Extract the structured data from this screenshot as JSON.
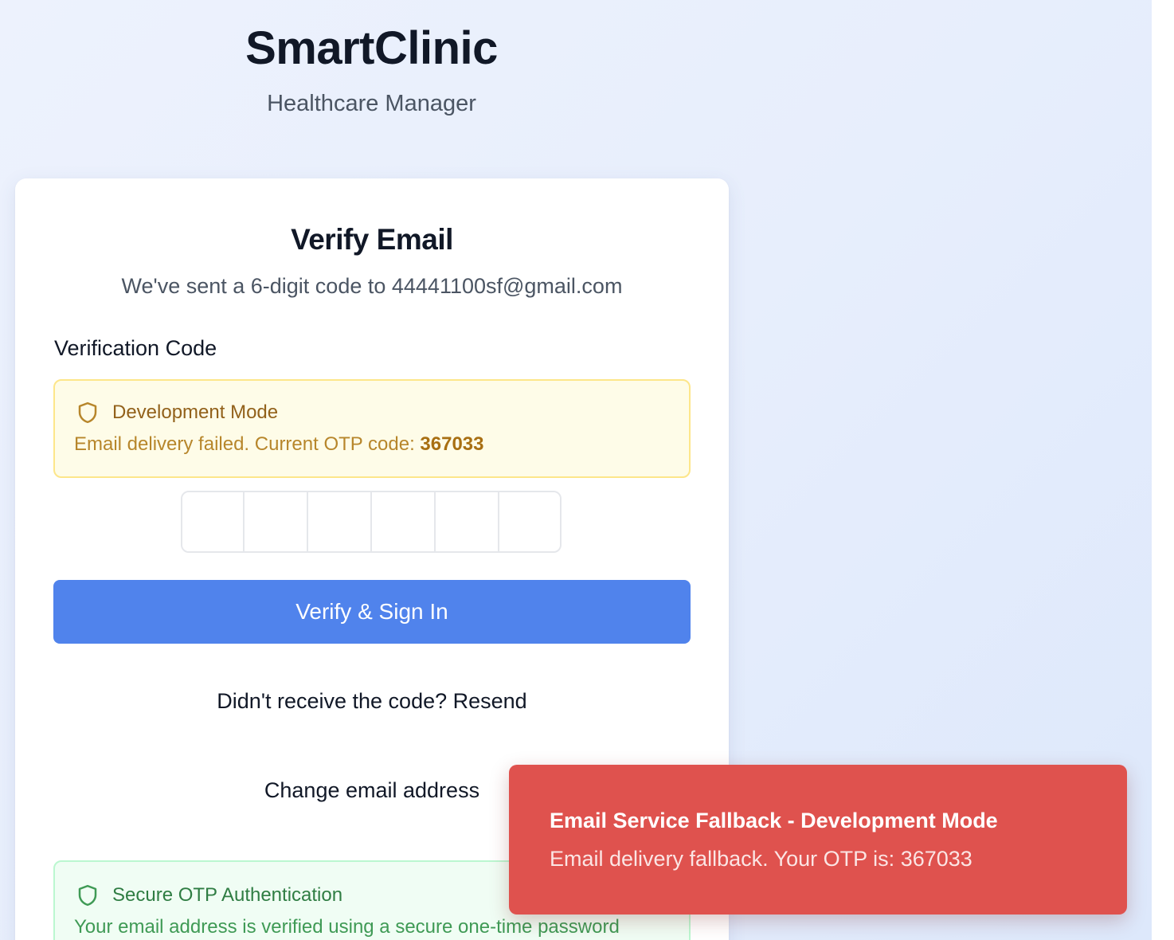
{
  "brand": {
    "title": "SmartClinic",
    "subtitle": "Healthcare Manager"
  },
  "card": {
    "title": "Verify Email",
    "subtitle": "We've sent a 6-digit code to 44441100sf@gmail.com",
    "field_label": "Verification Code",
    "dev_alert": {
      "icon": "shield-icon",
      "title": "Development Mode",
      "text_prefix": "Email delivery failed. Current OTP code: ",
      "code": "367033",
      "colors": {
        "background": "#fefce8",
        "border": "#fde68a",
        "text": "#b7862b"
      }
    },
    "otp": {
      "digits": [
        "",
        "",
        "",
        "",
        "",
        ""
      ]
    },
    "verify_button": {
      "label": "Verify & Sign In",
      "color": "#5083ec"
    },
    "resend_link": "Didn't receive the code? Resend",
    "change_email_link": "Change email address",
    "secure_alert": {
      "icon": "shield-icon",
      "title": "Secure OTP Authentication",
      "text": "Your email address is verified using a secure one-time password",
      "colors": {
        "background": "#f0fdf4",
        "border": "#bbf7d0",
        "text": "#3f9a55"
      }
    }
  },
  "toast": {
    "title": "Email Service Fallback - Development Mode",
    "message": "Email delivery fallback. Your OTP is: 367033",
    "color": "#df524e"
  }
}
